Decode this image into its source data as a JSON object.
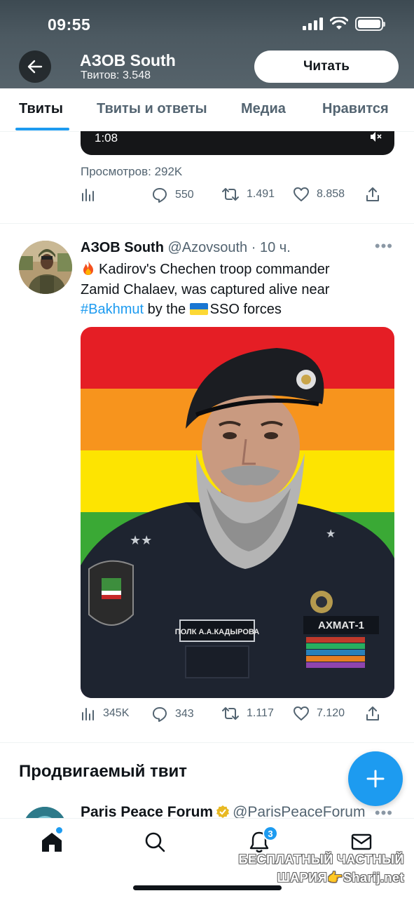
{
  "status_bar": {
    "time": "09:55"
  },
  "header": {
    "profile_name": "АЗОВ South",
    "tweet_count": "Твитов: 3.548",
    "follow_label": "Читать"
  },
  "tabs": [
    {
      "label": "Твиты",
      "active": true
    },
    {
      "label": "Твиты и ответы",
      "active": false
    },
    {
      "label": "Медиа",
      "active": false
    },
    {
      "label": "Нравится",
      "active": false
    }
  ],
  "tweet1": {
    "video_time": "1:08",
    "views": "Просмотров: 292K",
    "replies": "550",
    "retweets": "1.491",
    "likes": "8.858"
  },
  "tweet2": {
    "author": "АЗОВ South",
    "handle": "@Azovsouth",
    "time": "10 ч.",
    "text_line1": "Kadirov's Chechen troop commander",
    "text_line2": "Zamid Chalaev, was captured alive near",
    "hashtag": "#Bakhmut",
    "text_by": "by the",
    "text_end": "SSO forces",
    "photo_cap_text": "",
    "photo_patch_left": "ПОЛК А.А.КАДЫРОВА",
    "photo_patch_right": "АХМАТ-1",
    "views": "345K",
    "replies": "343",
    "retweets": "1.117",
    "likes": "7.120"
  },
  "promo": {
    "title": "Продвигаемый твит",
    "author": "Paris Peace Forum",
    "handle": "@ParisPeaceForum"
  },
  "bottom_nav": {
    "notifications_badge": "3"
  },
  "watermark": {
    "line1": "БЕСПЛАТНЫЙ ЧАСТНЫЙ",
    "line2": "ШАРИЯ👉Sharij.net"
  },
  "colors": {
    "accent": "#1d9bf0",
    "text": "#0f1419",
    "secondary": "#536471"
  },
  "icons": [
    "back-arrow-icon",
    "wifi-icon",
    "battery-icon",
    "mute-icon",
    "stats-icon",
    "reply-icon",
    "retweet-icon",
    "like-icon",
    "share-icon",
    "more-icon",
    "verified-icon",
    "compose-icon",
    "home-icon",
    "search-icon",
    "bell-icon",
    "mail-icon"
  ]
}
